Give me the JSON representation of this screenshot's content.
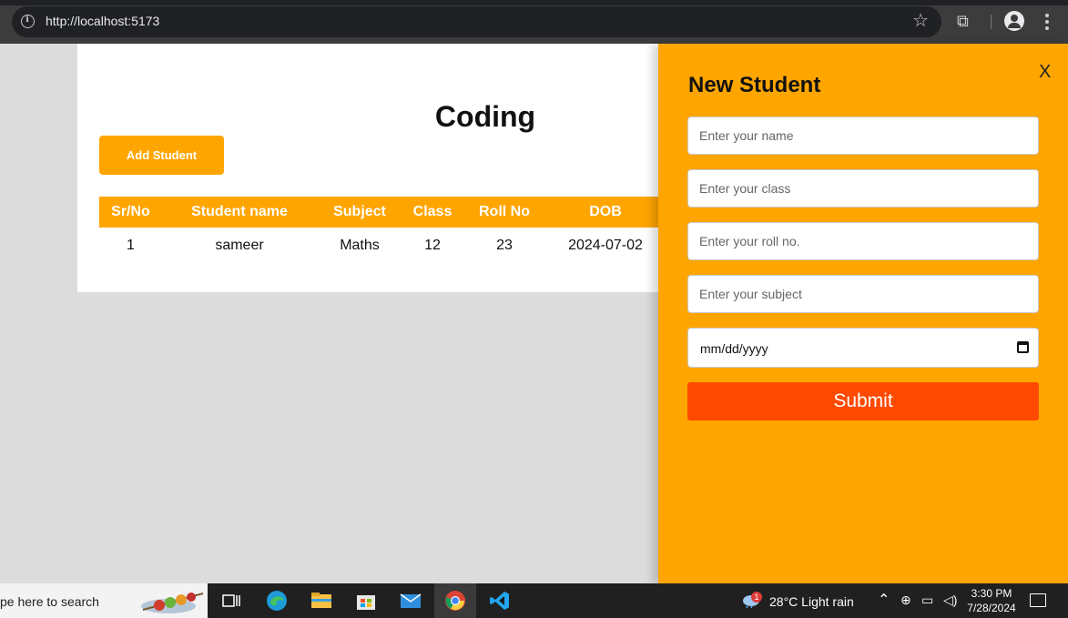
{
  "browser": {
    "url": "http://localhost:5173",
    "icons": [
      "info-icon",
      "star-icon",
      "extensions-icon",
      "profile-icon",
      "menu-icon"
    ]
  },
  "page": {
    "title": "Coding",
    "add_button_label": "Add Student",
    "table": {
      "headers": [
        "Sr/No",
        "Student name",
        "Subject",
        "Class",
        "Roll No",
        "DOB"
      ],
      "rows": [
        [
          "1",
          "sameer",
          "Maths",
          "12",
          "23",
          "2024-07-02"
        ]
      ]
    }
  },
  "drawer": {
    "title": "New Student",
    "close_label": "X",
    "fields": {
      "name_placeholder": "Enter your name",
      "class_placeholder": "Enter your class",
      "roll_placeholder": "Enter your roll no.",
      "subject_placeholder": "Enter your subject",
      "date_placeholder": "mm/dd/yyyy"
    },
    "submit_label": "Submit"
  },
  "taskbar": {
    "search_text": "pe here to search",
    "weather": "28°C  Light rain",
    "weather_badge": "1",
    "time": "3:30 PM",
    "date": "7/28/2024",
    "apps": [
      "task-view-icon",
      "edge-icon",
      "file-explorer-icon",
      "store-icon",
      "mail-icon",
      "chrome-icon",
      "vscode-icon"
    ]
  },
  "colors": {
    "accent": "#ffa500",
    "submit": "#ff4a00",
    "background": "#dcdcdc"
  }
}
